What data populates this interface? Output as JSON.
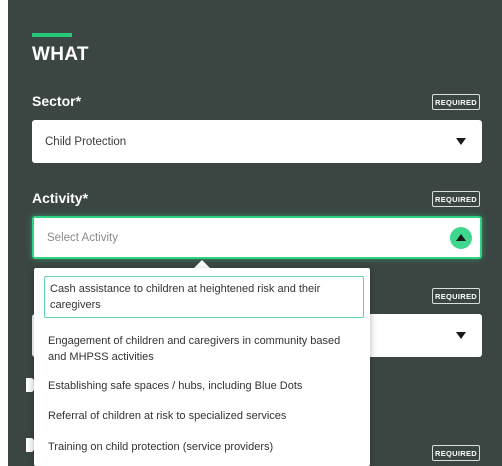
{
  "section": {
    "title": "WHAT"
  },
  "required_label": "REQUIRED",
  "sector": {
    "label": "Sector*",
    "value": "Child Protection"
  },
  "activity": {
    "label": "Activity*",
    "placeholder": "Select Activity",
    "options": [
      "Cash assistance to children at heightened risk and their caregivers",
      "Engagement of children and caregivers in community based and MHPSS activities",
      "Establishing safe spaces / hubs, including Blue Dots",
      "Referral of children at risk to specialized services",
      "Training on child protection (service providers)"
    ]
  },
  "colors": {
    "panel": "#3b4643",
    "accent": "#26c97b",
    "focus": "#2fd183"
  }
}
